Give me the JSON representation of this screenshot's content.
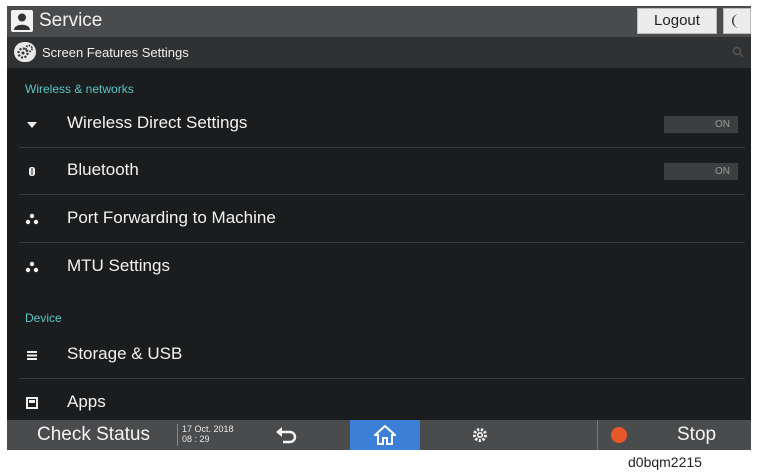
{
  "header": {
    "title": "Service",
    "logout_label": "Logout"
  },
  "subheader": {
    "title": "Screen Features Settings"
  },
  "sections": [
    {
      "title": "Wireless & networks",
      "items": [
        {
          "label": "Wireless Direct Settings",
          "icon": "wifi-icon",
          "toggle": "ON"
        },
        {
          "label": "Bluetooth",
          "icon": "bluetooth-icon",
          "toggle": "ON"
        },
        {
          "label": "Port Forwarding to Machine",
          "icon": "network-icon"
        },
        {
          "label": "MTU Settings",
          "icon": "network-icon"
        }
      ]
    },
    {
      "title": "Device",
      "items": [
        {
          "label": "Storage & USB",
          "icon": "storage-icon"
        },
        {
          "label": "Apps",
          "icon": "apps-icon"
        }
      ]
    }
  ],
  "bottombar": {
    "check_status": "Check Status",
    "date": "17 Oct. 2018",
    "time": "08 : 29",
    "stop_label": "Stop"
  },
  "caption": "d0bqm2215",
  "colors": {
    "background": "#1b1c1d",
    "bar": "#4a4b4d",
    "section_header": "#57c7c7",
    "home_active": "#3b7fd6",
    "stop": "#e8572a"
  }
}
